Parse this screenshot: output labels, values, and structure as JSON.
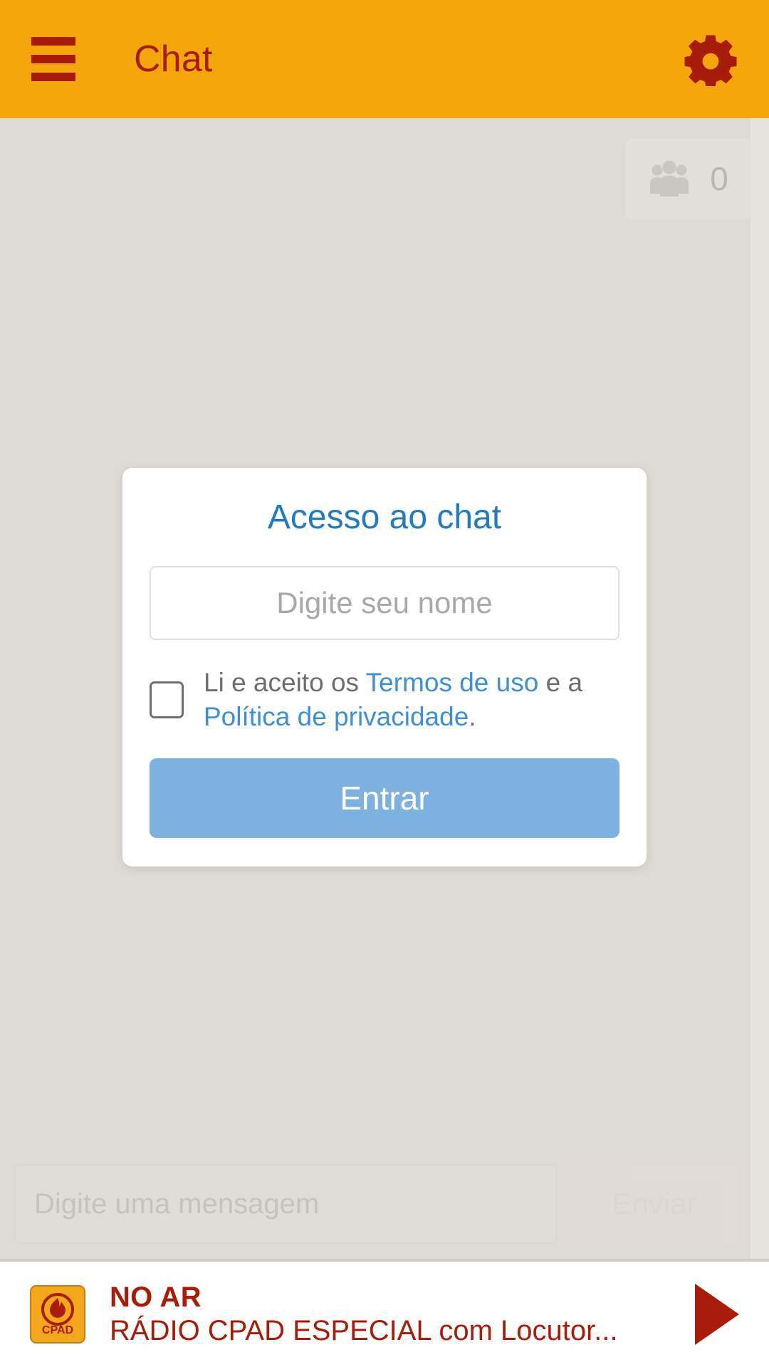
{
  "colors": {
    "header_bg": "#F5A60A",
    "header_fg": "#A61C09",
    "body_bg": "#DEDAD5",
    "accent_blue": "#1F7BC4",
    "link_blue": "#3D8FD8",
    "button_blue": "#7CB1E0",
    "brand_red": "#A81C09",
    "logo_orange": "#F3A81C"
  },
  "topbar": {
    "menu_icon": "hamburger-menu-icon",
    "title": "Chat",
    "settings_icon": "gear-icon"
  },
  "chat": {
    "participants": {
      "icon": "people-group-icon",
      "count": "0"
    }
  },
  "modal": {
    "title": "Acesso ao chat",
    "name_input": {
      "value": "",
      "placeholder": "Digite seu nome"
    },
    "terms": {
      "checked": false,
      "prefix": "Li e aceito os ",
      "link_terms": "Termos de uso",
      "middle": " e a ",
      "link_privacy": "Política de privacidade",
      "suffix": "."
    },
    "submit_label": "Entrar"
  },
  "composer": {
    "input": {
      "value": "",
      "placeholder": "Digite uma mensagem"
    },
    "send_label": "Enviar"
  },
  "player": {
    "logo_text": "CPAD",
    "logo_icon": "cpad-flame-logo-icon",
    "status": "NO AR",
    "program": "RÁDIO CPAD ESPECIAL com Locutor...",
    "play_icon": "play-icon"
  }
}
